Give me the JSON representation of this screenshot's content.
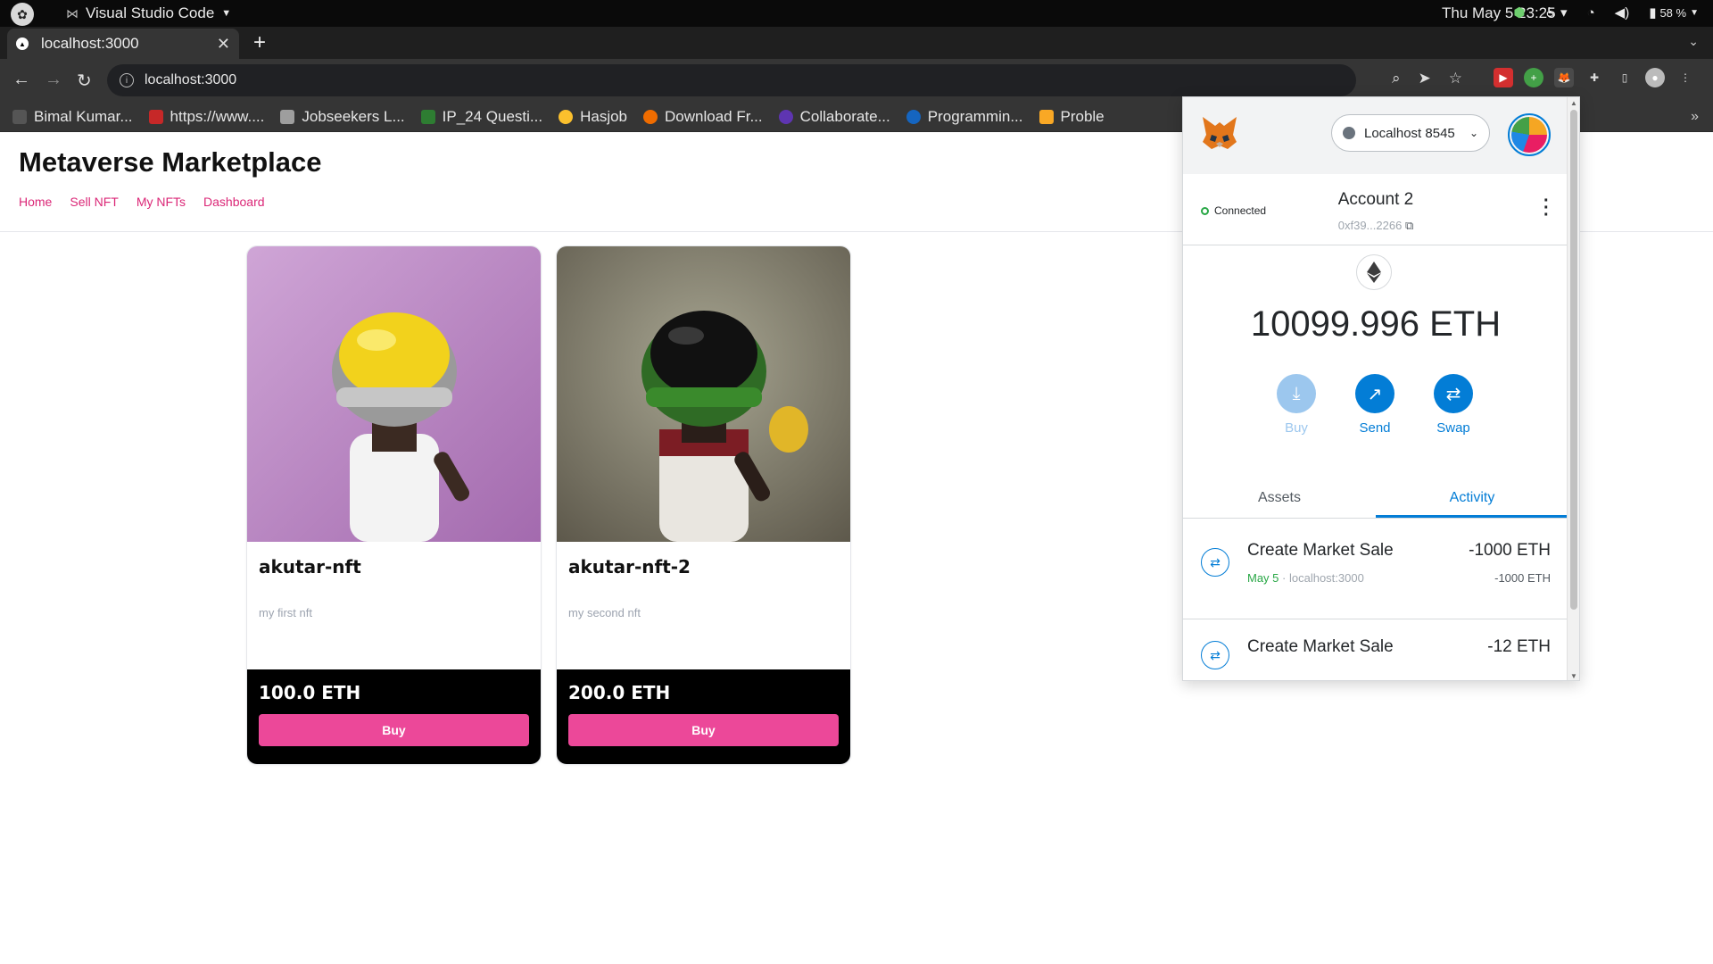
{
  "os": {
    "app_name": "Visual Studio Code",
    "clock": "Thu May 5  23:25",
    "battery": "58 %"
  },
  "browser": {
    "tab_title": "localhost:3000",
    "url": "localhost:3000",
    "bookmarks": [
      {
        "label": "Bimal Kumar...",
        "color": "#555555"
      },
      {
        "label": "https://www....",
        "color": "#c62828"
      },
      {
        "label": "Jobseekers L...",
        "color": "#9e9e9e"
      },
      {
        "label": "IP_24 Questi...",
        "color": "#2e7d32"
      },
      {
        "label": "Hasjob",
        "color": "#fbc02d"
      },
      {
        "label": "Download Fr...",
        "color": "#ef6c00"
      },
      {
        "label": "Collaborate...",
        "color": "#5e35b1"
      },
      {
        "label": "Programmin...",
        "color": "#1565c0"
      },
      {
        "label": "Proble",
        "color": "#f9a825"
      }
    ]
  },
  "site": {
    "title": "Metaverse Marketplace",
    "nav": [
      "Home",
      "Sell NFT",
      "My NFTs",
      "Dashboard"
    ],
    "accent_color": "#db2777",
    "nfts": [
      {
        "name": "akutar-nft",
        "description": "my first nft",
        "price": "100.0 ETH",
        "buy_label": "Buy"
      },
      {
        "name": "akutar-nft-2",
        "description": "my second nft",
        "price": "200.0 ETH",
        "buy_label": "Buy"
      }
    ]
  },
  "metamask": {
    "network": "Localhost 8545",
    "status": "Connected",
    "account_name": "Account 2",
    "account_address": "0xf39...2266",
    "balance": "10099.996 ETH",
    "actions": [
      "Buy",
      "Send",
      "Swap"
    ],
    "tabs": [
      "Assets",
      "Activity"
    ],
    "active_tab": "Activity",
    "accent_color": "#037dd6",
    "activity": [
      {
        "title": "Create Market Sale",
        "amount": "-1000 ETH",
        "date": "May 5",
        "origin": "localhost:3000",
        "amount_secondary": "-1000 ETH"
      },
      {
        "title": "Create Market Sale",
        "amount": "-12 ETH",
        "date": "",
        "origin": "",
        "amount_secondary": ""
      }
    ]
  }
}
